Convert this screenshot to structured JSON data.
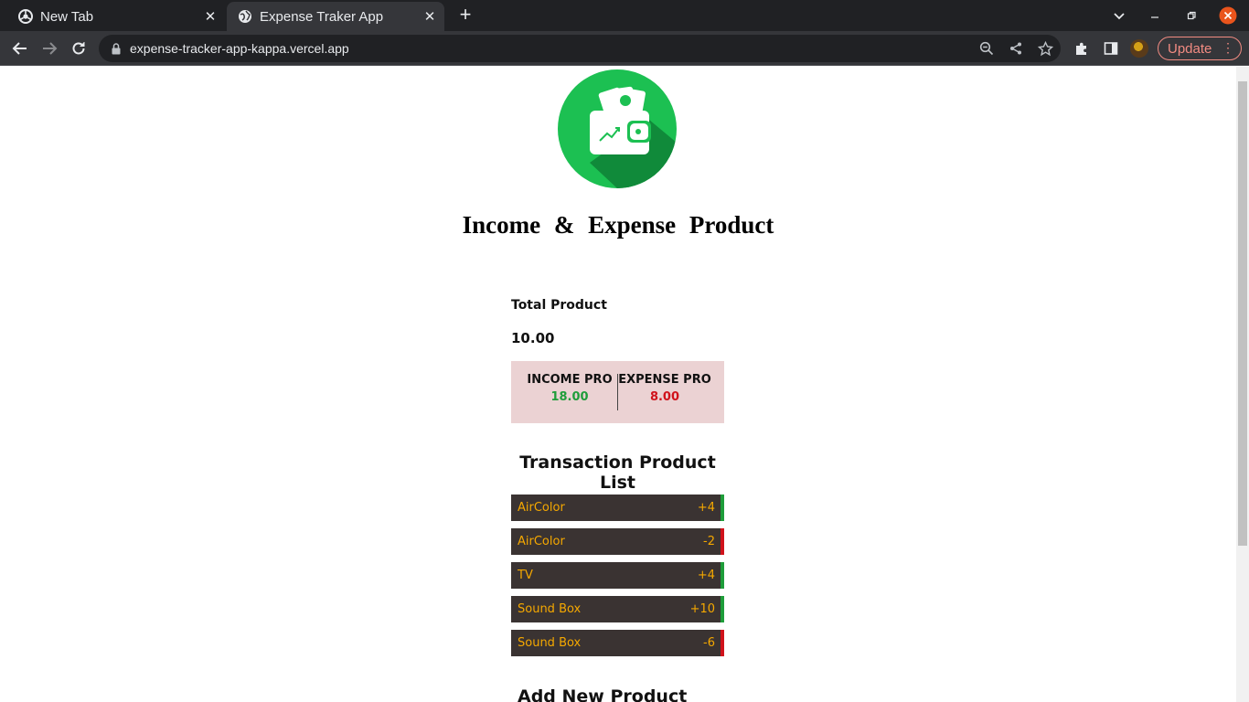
{
  "browser": {
    "tabs": [
      {
        "title": "New Tab",
        "icon": "chrome-icon"
      },
      {
        "title": "Expense Traker App",
        "icon": "globe-icon",
        "active": true
      }
    ],
    "url": "expense-tracker-app-kappa.vercel.app",
    "update_label": "Update"
  },
  "page": {
    "heading": "Income & Expense Product",
    "total_label": "Total Product",
    "total_value": "10.00",
    "income_label": "INCOME PRO",
    "income_value": "18.00",
    "expense_label": "EXPENSE PRO",
    "expense_value": "8.00",
    "list_title": "Transaction Product List",
    "transactions": [
      {
        "name": "AirColor",
        "amount": "+4",
        "type": "income"
      },
      {
        "name": "AirColor",
        "amount": "-2",
        "type": "expense"
      },
      {
        "name": "TV",
        "amount": "+4",
        "type": "income"
      },
      {
        "name": "Sound Box",
        "amount": "+10",
        "type": "income"
      },
      {
        "name": "Sound Box",
        "amount": "-6",
        "type": "expense"
      }
    ],
    "add_title": "Add New Product"
  },
  "colors": {
    "income": "#1f9d3a",
    "expense": "#d0121b",
    "row_bg": "#3a3332",
    "row_text": "#f5a800",
    "summary_bg": "#ebd2d3",
    "logo_green": "#1cc052"
  }
}
